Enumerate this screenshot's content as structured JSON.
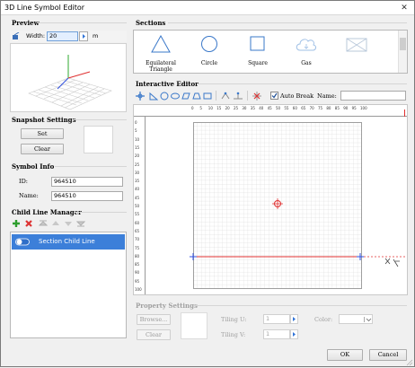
{
  "window": {
    "title": "3D Line Symbol Editor",
    "close_glyph": "✕"
  },
  "preview": {
    "group_label": "Preview",
    "width_label": "Width:",
    "width_value": "20",
    "width_unit": "m"
  },
  "snapshot": {
    "group_label": "Snapshot Settings",
    "set_label": "Set",
    "clear_label": "Clear"
  },
  "symbol_info": {
    "group_label": "Symbol Info",
    "id_label": "ID:",
    "id_value": "964510",
    "name_label": "Name:",
    "name_value": "964510"
  },
  "child_line_manager": {
    "group_label": "Child Line Manager",
    "items": [
      {
        "label": "Section Child Line",
        "selected": true
      }
    ]
  },
  "sections": {
    "group_label": "Sections",
    "items": [
      {
        "label": "Equilateral Triangle"
      },
      {
        "label": "Circle"
      },
      {
        "label": "Square"
      },
      {
        "label": "Gas"
      },
      {
        "label": ""
      }
    ]
  },
  "editor": {
    "group_label": "Interactive Editor",
    "auto_break_label": "Auto Break",
    "auto_break_checked": true,
    "name_label": "Name:",
    "name_value": "",
    "ruler_ticks": [
      "0",
      "5",
      "10",
      "15",
      "20",
      "25",
      "30",
      "35",
      "40",
      "45",
      "50",
      "55",
      "60",
      "65",
      "70",
      "75",
      "80",
      "85",
      "90",
      "95",
      "100"
    ],
    "vertical_ticks": [
      "0",
      "5",
      "10",
      "15",
      "20",
      "25",
      "30",
      "35",
      "40",
      "45",
      "50",
      "55",
      "60",
      "65",
      "70",
      "75",
      "80",
      "85",
      "90",
      "95",
      "100"
    ]
  },
  "property": {
    "group_label": "Property Settings",
    "browse_label": "Browse...",
    "clear_label": "Clear",
    "tiling_u_label": "Tiling U:",
    "tiling_u_value": "1",
    "tiling_v_label": "Tiling V:",
    "tiling_v_value": "1",
    "color_label": "Color:"
  },
  "footer": {
    "ok_label": "OK",
    "cancel_label": "Cancel"
  },
  "colors": {
    "accent": "#3174d8",
    "selection": "#3c7fd9",
    "axis_x": "#e03030",
    "axis_y": "#2faa2f",
    "axis_z": "#2f4fe0"
  }
}
